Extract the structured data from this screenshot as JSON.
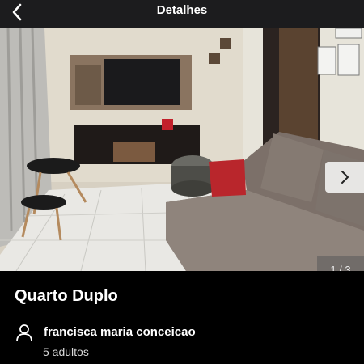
{
  "header": {
    "title": "Detalhes",
    "back_icon": "chevron-left-icon"
  },
  "gallery": {
    "counter": "1 / 3",
    "next_icon": "chevron-right-icon",
    "current": 1,
    "total": 3
  },
  "listing": {
    "room_name": "Quarto Duplo",
    "host_icon": "person-icon",
    "host_name": "francisca maria conceicao",
    "guests": "5 adultos"
  }
}
